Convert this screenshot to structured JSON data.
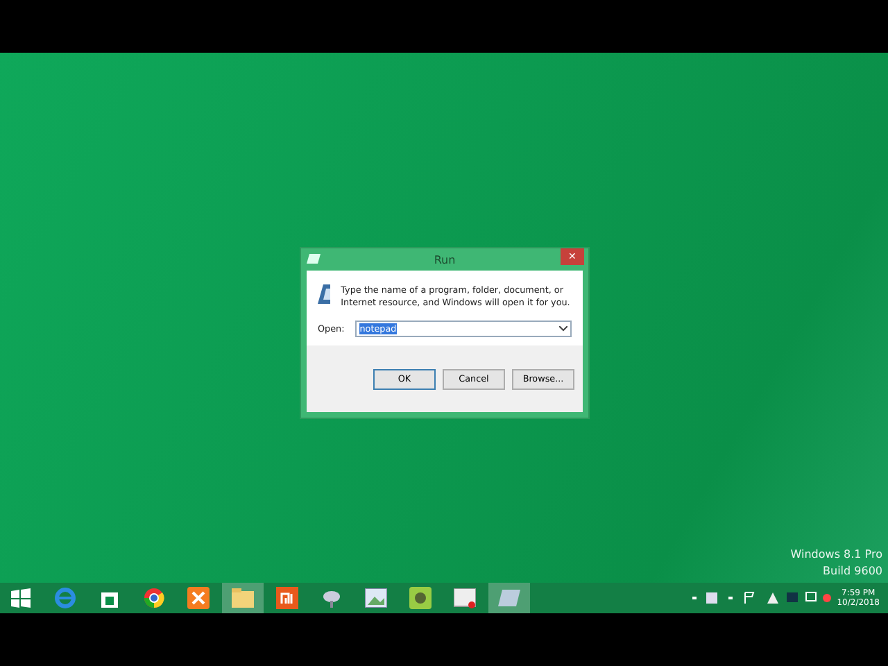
{
  "dialog": {
    "title": "Run",
    "close": "✕",
    "description": "Type the name of a program, folder, document, or Internet resource, and Windows will open it for you.",
    "open_label": "Open:",
    "open_value": "notepad",
    "buttons": [
      {
        "label": "OK",
        "default": true
      },
      {
        "label": "Cancel",
        "default": false
      },
      {
        "label": "Browse...",
        "default": false
      }
    ]
  },
  "desktop_text": [
    "Windows 8.1 Pro",
    "Build 9600"
  ],
  "taskbar": {
    "apps": [
      {
        "kind": "start",
        "active": false
      },
      {
        "kind": "ie",
        "active": false
      },
      {
        "kind": "store",
        "active": false
      },
      {
        "kind": "chrome",
        "active": false
      },
      {
        "kind": "xampp",
        "active": false
      },
      {
        "kind": "explorer",
        "active": true
      },
      {
        "kind": "mi",
        "active": false
      },
      {
        "kind": "tool",
        "active": false
      },
      {
        "kind": "paint",
        "active": false
      },
      {
        "kind": "game",
        "active": false
      },
      {
        "kind": "screen",
        "active": false
      },
      {
        "kind": "run",
        "active": true
      }
    ],
    "time": "7:59 PM",
    "date": "10/2/2018"
  }
}
